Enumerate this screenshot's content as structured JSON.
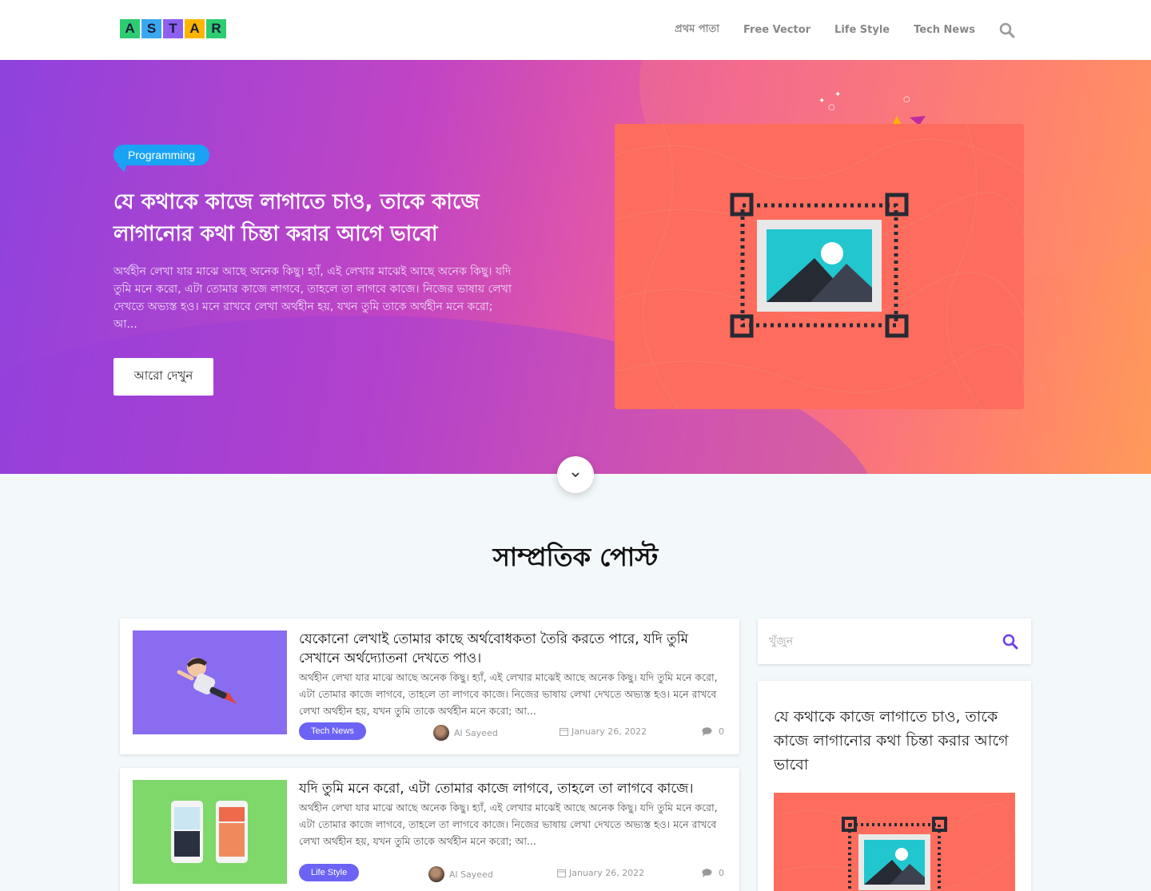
{
  "header": {
    "logo_letters": [
      "A",
      "S",
      "T",
      "A",
      "R"
    ],
    "logo_colors": [
      "#2ecc71",
      "#3aa8f0",
      "#8e60f0",
      "#ffb400",
      "#2ecc71"
    ],
    "nav": [
      "প্রথম পাতা",
      "Free Vector",
      "Life Style",
      "Tech News"
    ]
  },
  "hero": {
    "category": "Programming",
    "title": "যে কথাকে কাজে লাগাতে চাও, তাকে কাজে লাগানোর কথা চিন্তা করার আগে ভাবো",
    "excerpt": "অর্থহীন লেখা যার মাঝে আছে অনেক কিছু। হ্যাঁ, এই লেখার মাঝেই আছে অনেক কিছু। যদি তুমি মনে করো, এটা তোমার কাজে লাগবে, তাহলে তা লাগবে কাজে। নিজের ভাষায় লেখা দেখতে অভ্যস্ত হও। মনে রাখবে লেখা অর্থহীন হয়, যখন তুমি তাকে অর্থহীন মনে করো; আ...",
    "button": "আরো দেখুন"
  },
  "section": {
    "title": "সাম্প্রতিক পোস্ট"
  },
  "posts": [
    {
      "title": "যেকোনো লেখাই তোমার কাছে অর্থবোধকতা তৈরি করতে পারে, যদি তুমি সেখানে অর্থদ্যোতনা দেখতে পাও।",
      "excerpt": "অর্থহীন লেখা যার মাঝে আছে অনেক কিছু। হ্যাঁ, এই লেখার মাঝেই আছে অনেক কিছু। যদি তুমি মনে করো, এটা তোমার কাজে লাগবে, তাহলে তা লাগবে কাজে। নিজের ভাষায় লেখা দেখতে অভ্যস্ত হও। মনে রাখবে লেখা অর্থহীন হয়, যখন তুমি তাকে অর্থহীন মনে করো; আ...",
      "tag": "Tech News",
      "tag_color": "#6c63f5",
      "author": "Al Sayeed",
      "date": "January 26, 2022",
      "comments": "0",
      "thumb_color": "#8a6cf0"
    },
    {
      "title": "যদি তুমি মনে করো, এটা তোমার কাজে লাগবে, তাহলে তা লাগবে কাজে।",
      "excerpt": "অর্থহীন লেখা যার মাঝে আছে অনেক কিছু। হ্যাঁ, এই লেখার মাঝেই আছে অনেক কিছু। যদি তুমি মনে করো, এটা তোমার কাজে লাগবে, তাহলে তা লাগবে কাজে। নিজের ভাষায় লেখা দেখতে অভ্যস্ত হও। মনে রাখবে লেখা অর্থহীন হয়, যখন তুমি তাকে অর্থহীন মনে করো; আ...",
      "tag": "Life Style",
      "tag_color": "#6c63f5",
      "author": "Al Sayeed",
      "date": "January 26, 2022",
      "comments": "0",
      "thumb_color": "#7fd86a"
    }
  ],
  "sidebar": {
    "search_placeholder": "খুঁজুন",
    "featured_title": "যে কথাকে কাজে লাগাতে চাও, তাকে কাজে লাগানোর কথা চিন্তা করার আগে ভাবো"
  },
  "colors": {
    "accent": "#6c3cf0",
    "badge_blue": "#1aa3f5",
    "image_bg": "#fd6c5d"
  }
}
